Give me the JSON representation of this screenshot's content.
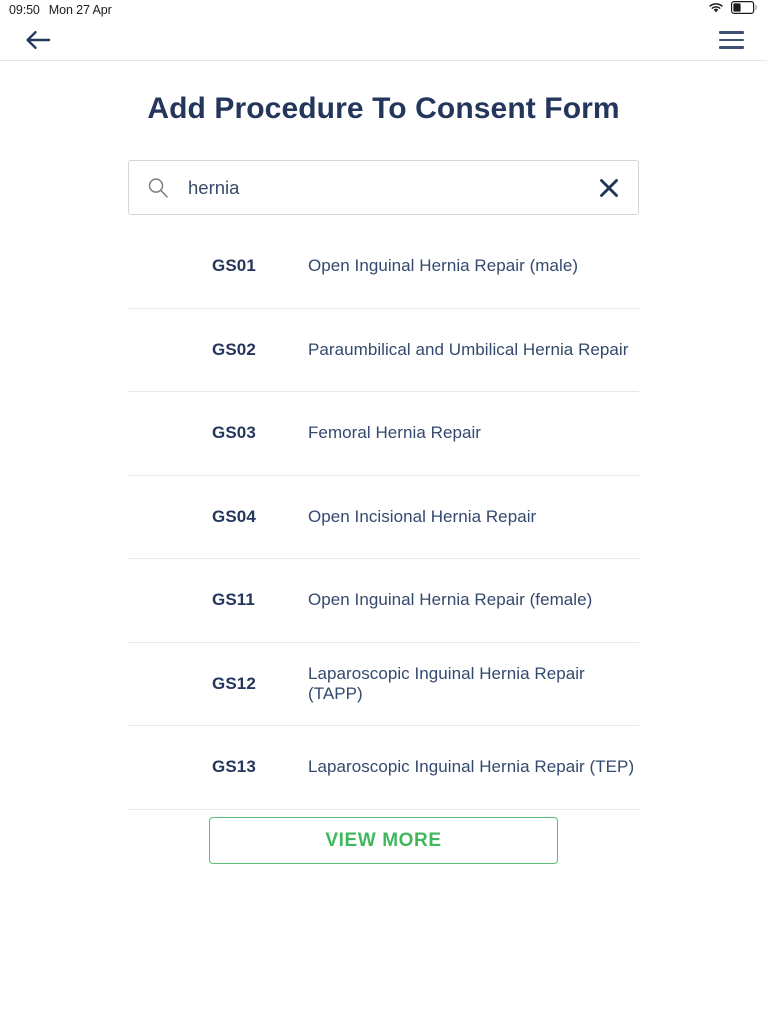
{
  "status_bar": {
    "time": "09:50",
    "date": "Mon 27 Apr",
    "wifi_icon": "wifi-icon",
    "battery_icon": "battery-icon",
    "battery_level_pct": 35
  },
  "nav": {
    "back_icon": "back-arrow-icon",
    "menu_icon": "hamburger-menu-icon"
  },
  "header": {
    "title": "Add Procedure To Consent Form"
  },
  "search": {
    "value": "hernia",
    "placeholder": "Search",
    "search_icon": "search-icon",
    "clear_icon": "close-icon"
  },
  "results": [
    {
      "code": "GS01",
      "name": "Open Inguinal Hernia Repair (male)"
    },
    {
      "code": "GS02",
      "name": "Paraumbilical and Umbilical Hernia Repair"
    },
    {
      "code": "GS03",
      "name": "Femoral Hernia Repair"
    },
    {
      "code": "GS04",
      "name": "Open Incisional Hernia Repair"
    },
    {
      "code": "GS11",
      "name": "Open Inguinal Hernia Repair (female)"
    },
    {
      "code": "GS12",
      "name": "Laparoscopic Inguinal Hernia Repair (TAPP)"
    },
    {
      "code": "GS13",
      "name": "Laparoscopic Inguinal Hernia Repair (TEP)"
    }
  ],
  "actions": {
    "view_more_label": "VIEW MORE"
  },
  "colors": {
    "title_navy": "#24365c",
    "text_navy": "#34496e",
    "accent_green": "#41b75d",
    "border_green": "#5bbd72",
    "divider_gray": "#e8e8ea",
    "input_border": "#d3d5d9"
  }
}
